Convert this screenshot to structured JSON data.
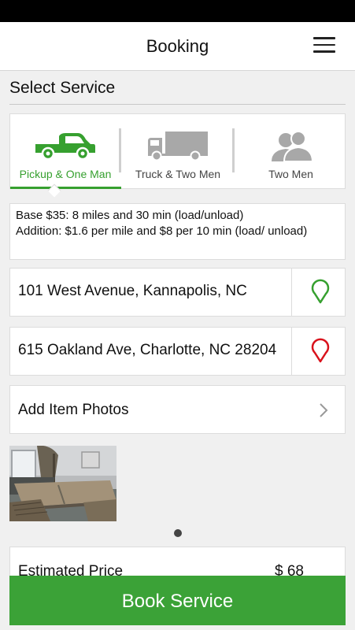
{
  "header": {
    "title": "Booking",
    "menu_icon": "hamburger-menu-icon"
  },
  "section": {
    "title": "Select Service"
  },
  "services": [
    {
      "label": "Pickup & One Man",
      "icon": "pickup-truck-icon",
      "selected": true,
      "color": "#36a02f"
    },
    {
      "label": "Truck & Two Men",
      "icon": "box-truck-icon",
      "selected": false,
      "color": "#a8a8a8"
    },
    {
      "label": "Two Men",
      "icon": "two-people-icon",
      "selected": false,
      "color": "#a8a8a8"
    }
  ],
  "pricing": {
    "base": "Base $35: 8 miles and 30 min (load/unload)",
    "addition": "Addition:  $1.6 per mile and $8 per 10 min (load/ unload)"
  },
  "pickup": {
    "address": "101 West Avenue, Kannapolis, NC",
    "pin_color": "#36a02f"
  },
  "dropoff": {
    "address": "615 Oakland Ave, Charlotte, NC 28204",
    "pin_color": "#d9121c"
  },
  "photos": {
    "label": "Add Item Photos",
    "count": 1,
    "page_index": 1
  },
  "estimate": {
    "label": "Estimated Price",
    "value": "$ 68"
  },
  "book": {
    "label": "Book Service"
  },
  "colors": {
    "accent": "#3ba237",
    "background": "#f0f0f0"
  }
}
